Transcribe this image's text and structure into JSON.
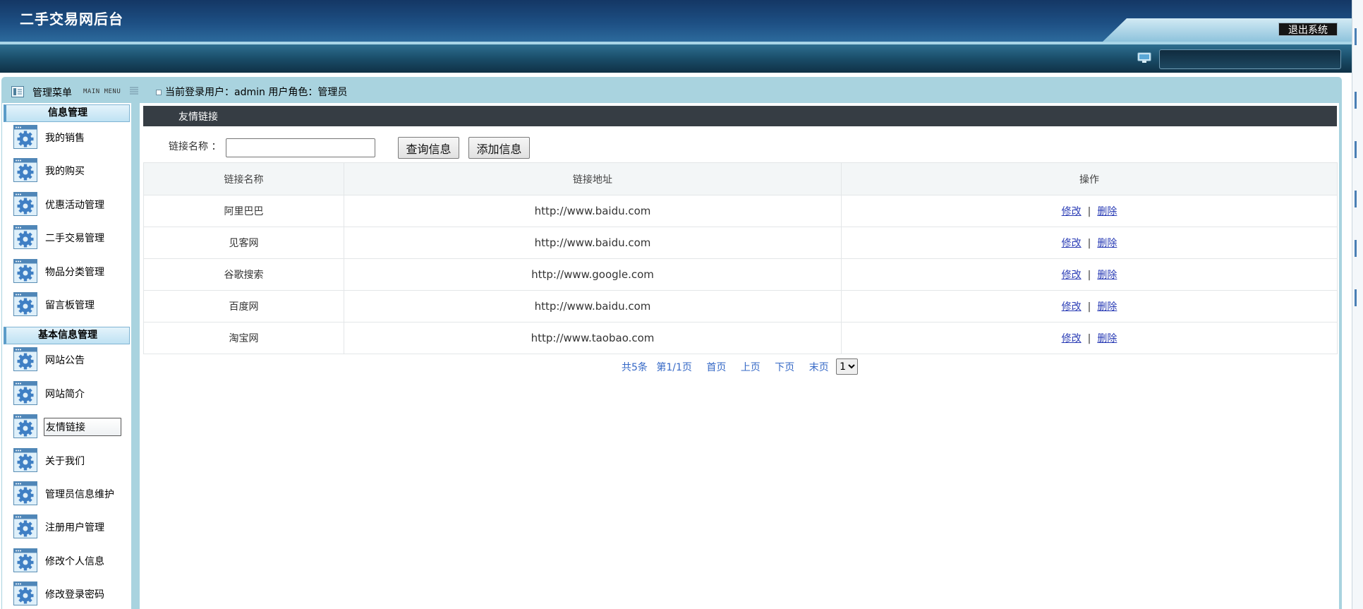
{
  "header": {
    "app_title": "二手交易网后台",
    "exit_label": "退出系统"
  },
  "menu": {
    "title": "管理菜单",
    "subtitle": "MAIN MENU"
  },
  "user_info": {
    "text": "当前登录用户：admin  用户角色：管理员"
  },
  "sidebar": {
    "sections": [
      {
        "title": "信息管理",
        "items": [
          "我的销售",
          "我的购买",
          "优惠活动管理",
          "二手交易管理",
          "物品分类管理",
          "留言板管理"
        ]
      },
      {
        "title": "基本信息管理",
        "items": [
          "网站公告",
          "网站简介",
          "友情链接",
          "关于我们",
          "管理员信息维护",
          "注册用户管理",
          "修改个人信息",
          "修改登录密码"
        ]
      }
    ],
    "active_item": "友情链接"
  },
  "page": {
    "title": "友情链接"
  },
  "search": {
    "label": "链接名称 ：",
    "value": "",
    "query_button": "查询信息",
    "add_button": "添加信息"
  },
  "table": {
    "columns": [
      "链接名称",
      "链接地址",
      "操作"
    ],
    "rows": [
      {
        "name": "阿里巴巴",
        "url": "http://www.baidu.com"
      },
      {
        "name": "见客网",
        "url": "http://www.baidu.com"
      },
      {
        "name": "谷歌搜索",
        "url": "http://www.google.com"
      },
      {
        "name": "百度网",
        "url": "http://www.baidu.com"
      },
      {
        "name": "淘宝网",
        "url": "http://www.taobao.com"
      }
    ],
    "edit_label": "修改",
    "separator": "|",
    "delete_label": "删除"
  },
  "pagination": {
    "total": "共5条",
    "page_info": "第1/1页",
    "first": "首页",
    "prev": "上页",
    "next": "下页",
    "last": "末页",
    "selected_page": "1"
  },
  "colors": {
    "banner": "#1d4f83",
    "frame": "#a9d3df",
    "title_bar": "#363d44",
    "link": "#2a3cb5",
    "pager": "#3568c6"
  }
}
